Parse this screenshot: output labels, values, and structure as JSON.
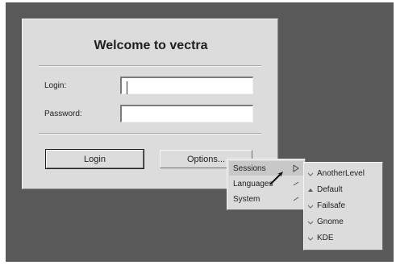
{
  "dialog": {
    "title": "Welcome to vectra",
    "login_label": "Login:",
    "password_label": "Password:",
    "login_value": "",
    "password_value": "",
    "login_button": "Login",
    "options_button": "Options..."
  },
  "options_menu": {
    "items": [
      {
        "label": "Sessions",
        "icon": "submenu-arrow-icon",
        "highlighted": true
      },
      {
        "label": "Languages",
        "icon": "submenu-arrow-icon"
      },
      {
        "label": "System",
        "icon": "submenu-arrow-icon"
      }
    ]
  },
  "sessions_menu": {
    "items": [
      {
        "label": "AnotherLevel",
        "icon": "radio-off-icon"
      },
      {
        "label": "Default",
        "icon": "radio-on-icon",
        "selected": true
      },
      {
        "label": "Failsafe",
        "icon": "radio-off-icon"
      },
      {
        "label": "Gnome",
        "icon": "radio-off-icon"
      },
      {
        "label": "KDE",
        "icon": "radio-off-icon"
      }
    ]
  },
  "colors": {
    "desktop": "#595959",
    "panel": "#dcdcdc",
    "text": "#1e1e1e"
  }
}
